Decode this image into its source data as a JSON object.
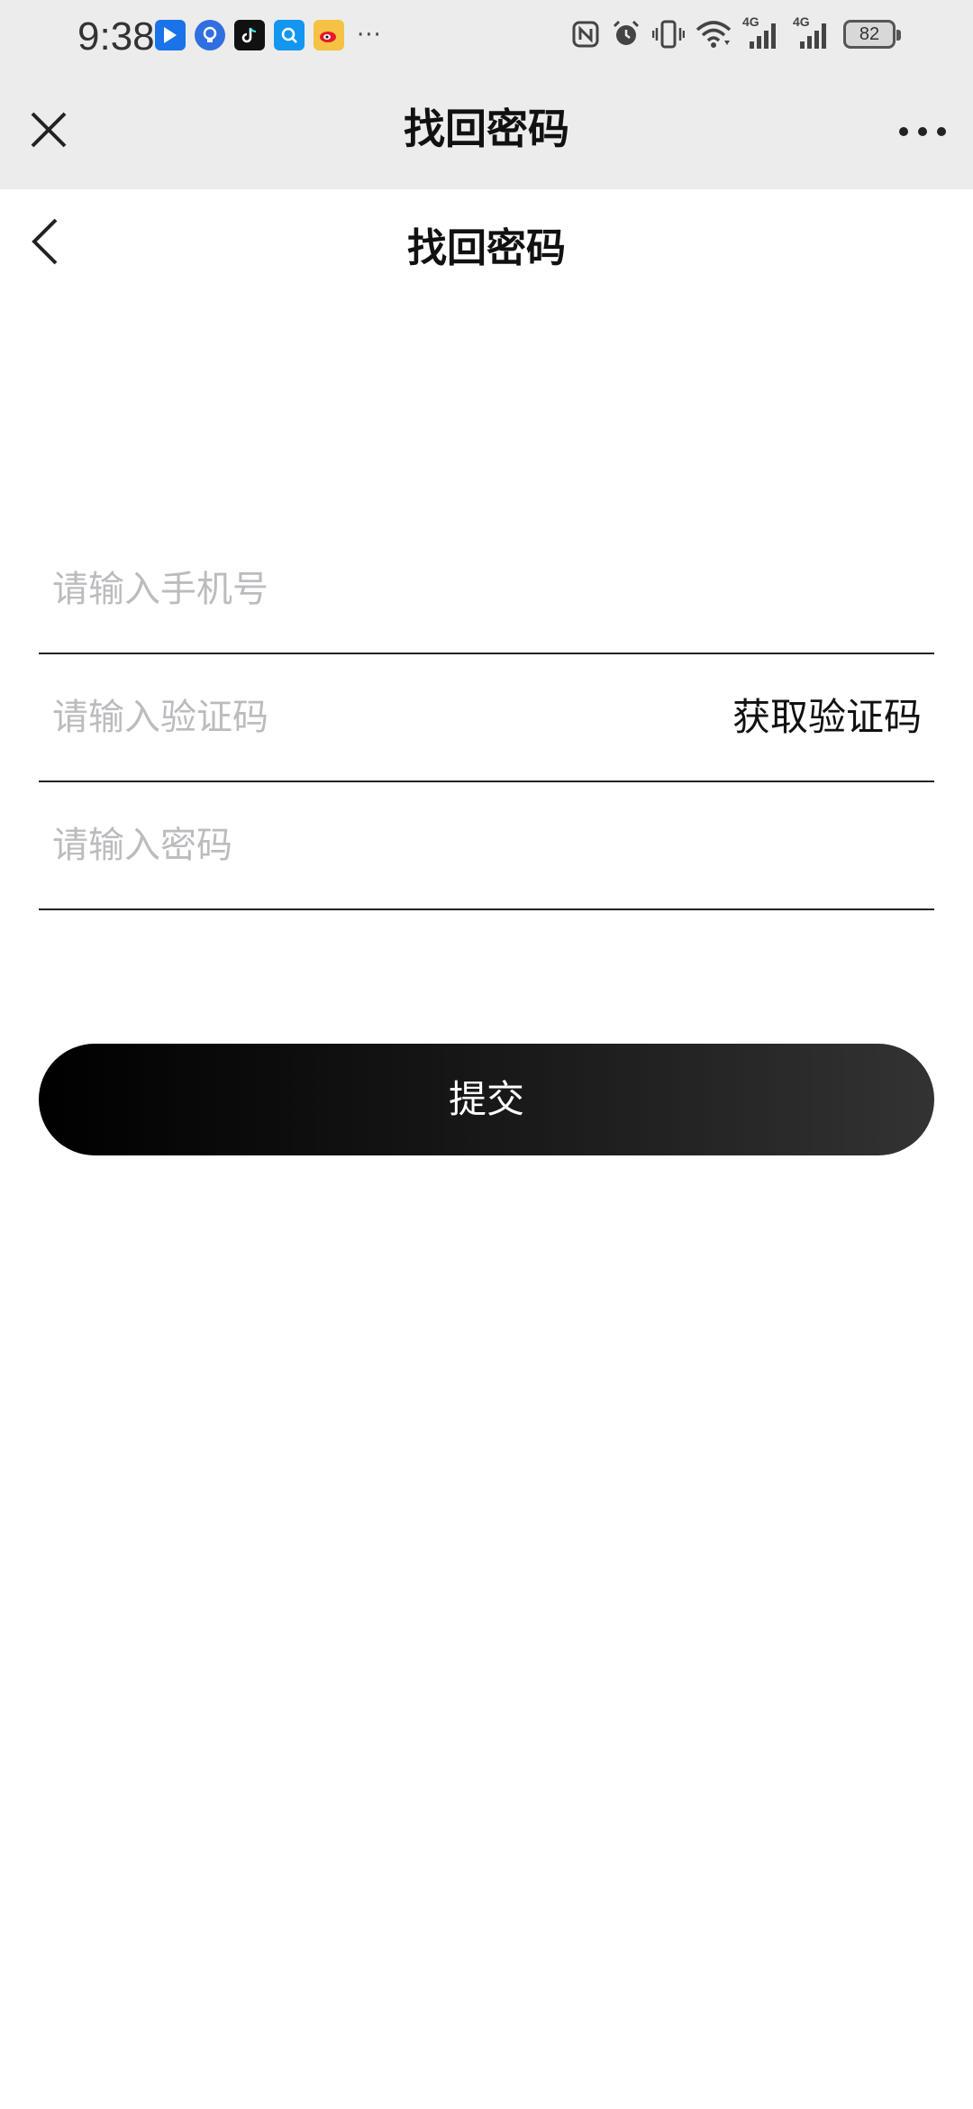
{
  "status_bar": {
    "time": "9:38",
    "app_icons": [
      {
        "name": "bookmark-app-icon",
        "color": "#1a73e8",
        "glyph": "▶"
      },
      {
        "name": "lightbulb-app-icon",
        "color": "#2f6fe0",
        "glyph": "◐"
      },
      {
        "name": "tiktok-app-icon",
        "color": "#111111",
        "glyph": "♪"
      },
      {
        "name": "search-app-icon",
        "color": "#1296f0",
        "glyph": "⌕"
      },
      {
        "name": "weibo-app-icon",
        "color": "#f5c243",
        "glyph": "◉"
      }
    ],
    "more": "···",
    "network_label_1": "4G",
    "network_label_2": "4G",
    "battery": "82"
  },
  "nav_bar": {
    "title": "找回密码"
  },
  "page": {
    "title": "找回密码"
  },
  "form": {
    "phone_placeholder": "请输入手机号",
    "code_placeholder": "请输入验证码",
    "get_code_label": "获取验证码",
    "password_placeholder": "请输入密码",
    "submit_label": "提交"
  },
  "colors": {
    "nav_background": "#ececec",
    "placeholder": "#bcbcc0",
    "button_start": "#000000",
    "button_end": "#333333"
  }
}
